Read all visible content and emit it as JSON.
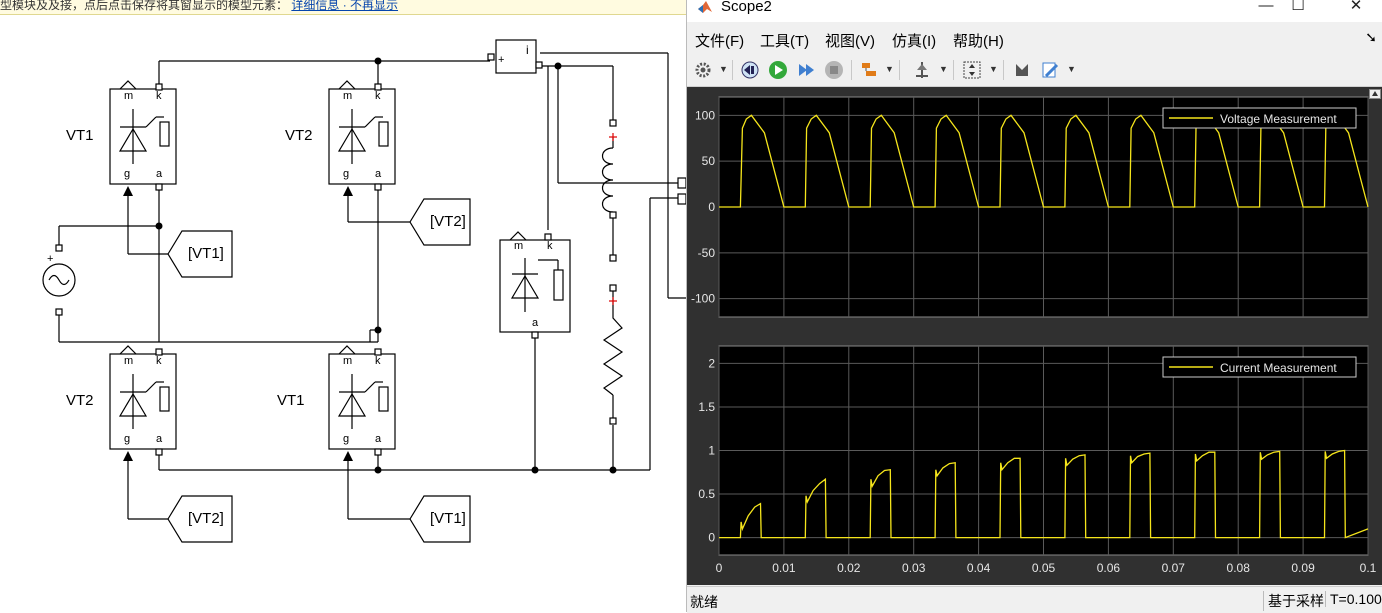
{
  "banner": {
    "text": "型模块及及接，点后点击保存将其窗显示的模型元素：",
    "link": "详细信息 · 不再显示"
  },
  "diagram": {
    "thyristors": [
      {
        "label": "VT1"
      },
      {
        "label": "VT2"
      },
      {
        "label": "VT2"
      },
      {
        "label": "VT1"
      }
    ],
    "port_labels": {
      "m": "m",
      "k": "k",
      "g": "g",
      "a": "a"
    },
    "goto_tags": [
      "[VT1]",
      "[VT2]",
      "[VT2]",
      "[VT1]"
    ],
    "source_plus": "+",
    "meas_minus": "-",
    "meas_plus": "+",
    "meas_i": "i"
  },
  "scope": {
    "title": "Scope2",
    "window_buttons": {
      "minimize": "—",
      "maximize": "☐",
      "close": "✕"
    },
    "menu": [
      "文件(F)",
      "工具(T)",
      "视图(V)",
      "仿真(I)",
      "帮助(H)"
    ],
    "menu_arrow": "➘",
    "toolbar_icons": [
      "settings-icon",
      "restore-icon",
      "run-icon",
      "step-forward-icon",
      "stop-icon",
      "signal-selector-icon",
      "cursor-measure-icon",
      "zoom-axes-icon",
      "style-icon",
      "edit-icon"
    ],
    "status": "就绪",
    "sample_mode": "基于采样",
    "time": "T=0.100",
    "colors": {
      "trace": "#f5e51b",
      "plot_bg": "#000000",
      "frame_bg": "#303030",
      "grid": "#5a5a5a",
      "text": "#e6e6e6"
    }
  },
  "chart_data": [
    {
      "type": "line",
      "title": "",
      "legend": [
        "Voltage Measurement"
      ],
      "legend_position": "top-right",
      "xlim": [
        0,
        0.1
      ],
      "ylim": [
        -120,
        120
      ],
      "yticks": [
        -100,
        -50,
        0,
        50,
        100
      ],
      "grid": true,
      "series": [
        {
          "name": "Voltage Measurement",
          "x": [
            0,
            0.0033,
            0.0036,
            0.0042,
            0.005,
            0.007,
            0.01,
            0.0105,
            0.0133,
            0.0135,
            0.0142,
            0.015,
            0.017,
            0.02,
            0.0205,
            0.0233,
            0.0235,
            0.0242,
            0.025,
            0.027,
            0.03,
            0.0305,
            0.0333,
            0.0335,
            0.0342,
            0.035,
            0.037,
            0.04,
            0.0405,
            0.0433,
            0.0435,
            0.0442,
            0.045,
            0.047,
            0.05,
            0.0505,
            0.0533,
            0.0535,
            0.0542,
            0.055,
            0.057,
            0.06,
            0.0605,
            0.0633,
            0.0635,
            0.0642,
            0.065,
            0.067,
            0.07,
            0.0705,
            0.0733,
            0.0735,
            0.0742,
            0.075,
            0.077,
            0.08,
            0.0805,
            0.0833,
            0.0835,
            0.0842,
            0.085,
            0.087,
            0.09,
            0.0905,
            0.0933,
            0.0935,
            0.0942,
            0.095,
            0.097,
            0.1
          ],
          "y": [
            0,
            0,
            86,
            96,
            100,
            81,
            0,
            0,
            0,
            86,
            96,
            100,
            81,
            0,
            0,
            0,
            86,
            96,
            100,
            81,
            0,
            0,
            0,
            86,
            96,
            100,
            81,
            0,
            0,
            0,
            86,
            96,
            100,
            81,
            0,
            0,
            0,
            86,
            96,
            100,
            81,
            0,
            0,
            0,
            86,
            96,
            100,
            81,
            0,
            0,
            0,
            86,
            96,
            100,
            81,
            0,
            0,
            0,
            86,
            96,
            100,
            81,
            0,
            0,
            0,
            86,
            96,
            100,
            81,
            0
          ]
        }
      ]
    },
    {
      "type": "line",
      "title": "",
      "legend": [
        "Current Measurement"
      ],
      "legend_position": "top-right",
      "xlim": [
        0,
        0.1
      ],
      "xticks": [
        0,
        0.01,
        0.02,
        0.03,
        0.04,
        0.05,
        0.06,
        0.07,
        0.08,
        0.09,
        0.1
      ],
      "ylim": [
        -0.2,
        2.2
      ],
      "yticks": [
        0,
        0.5,
        1,
        1.5,
        2
      ],
      "grid": true,
      "series": [
        {
          "name": "Current Measurement",
          "x": [
            0,
            0.0033,
            0.0034,
            0.0036,
            0.0045,
            0.0055,
            0.0064,
            0.0065,
            0.0133,
            0.0134,
            0.0136,
            0.0145,
            0.0155,
            0.0164,
            0.0165,
            0.0233,
            0.0234,
            0.0236,
            0.0245,
            0.0255,
            0.0264,
            0.0265,
            0.0333,
            0.0334,
            0.0336,
            0.0345,
            0.0355,
            0.0364,
            0.0365,
            0.0433,
            0.0434,
            0.0436,
            0.0445,
            0.0455,
            0.0464,
            0.0465,
            0.0533,
            0.0534,
            0.0536,
            0.0545,
            0.0555,
            0.0564,
            0.0565,
            0.0633,
            0.0634,
            0.0636,
            0.0645,
            0.0655,
            0.0664,
            0.0665,
            0.0733,
            0.0734,
            0.0736,
            0.0745,
            0.0755,
            0.0764,
            0.0765,
            0.0833,
            0.0834,
            0.0836,
            0.0845,
            0.0855,
            0.0864,
            0.0865,
            0.0933,
            0.0934,
            0.0936,
            0.0945,
            0.0955,
            0.0964,
            0.0965,
            0.1
          ],
          "y": [
            0,
            0,
            0.18,
            0.1,
            0.25,
            0.35,
            0.39,
            0,
            0,
            0.48,
            0.41,
            0.54,
            0.62,
            0.67,
            0,
            0,
            0.67,
            0.59,
            0.71,
            0.77,
            0.78,
            0,
            0,
            0.78,
            0.71,
            0.8,
            0.85,
            0.86,
            0,
            0,
            0.86,
            0.78,
            0.86,
            0.91,
            0.91,
            0,
            0,
            0.91,
            0.83,
            0.9,
            0.94,
            0.95,
            0,
            0,
            0.94,
            0.86,
            0.93,
            0.96,
            0.97,
            0,
            0,
            0.96,
            0.88,
            0.94,
            0.98,
            0.98,
            0,
            0,
            0.98,
            0.9,
            0.95,
            0.98,
            0.99,
            0,
            0,
            0.99,
            0.91,
            0.96,
            0.99,
            1.0,
            0,
            0.1
          ]
        }
      ]
    }
  ]
}
